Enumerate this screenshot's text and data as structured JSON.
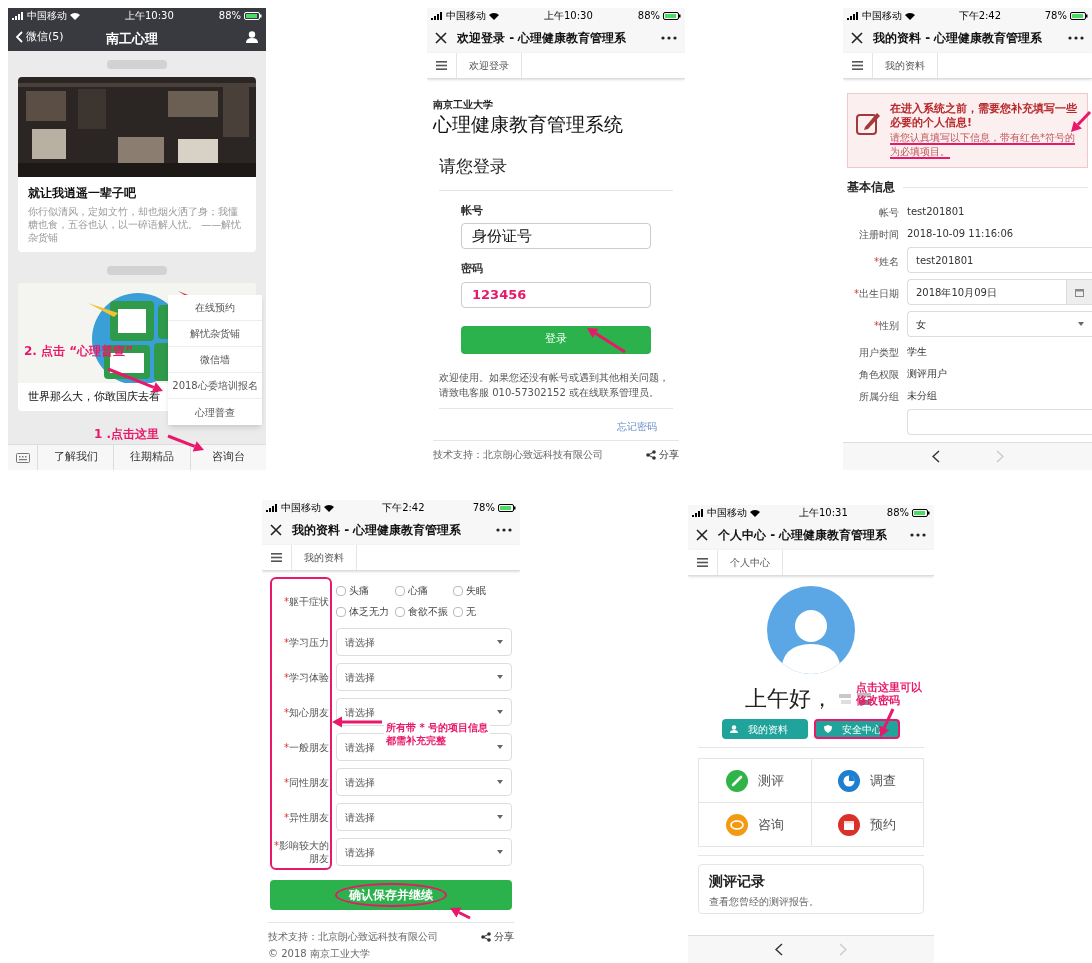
{
  "wechat_screen": {
    "status_bar": {
      "carrier": "中国移动",
      "time": "上午10:30",
      "battery": "88%"
    },
    "back_label": "微信(5)",
    "title": "南工心理",
    "articles": [
      {
        "title": "就让我逍遥一辈子吧",
        "summary": "你行似清风，定如文竹，却也烟火洒了身；我懂糖也食，五谷也认，以一碎语解人忧。 ——解忧杂货铺"
      },
      {
        "title": "世界那么大，你敢国庆去看"
      }
    ],
    "popup_menu": [
      "在线预约",
      "解忧杂货铺",
      "微信墙",
      "2018心委培训报名",
      "心理普查"
    ],
    "bottom_menu": [
      "了解我们",
      "往期精品",
      "咨询台"
    ],
    "annotations": [
      "2. 点击 “心理普查”",
      "1 .点击这里"
    ]
  },
  "login_screen": {
    "status_bar": {
      "carrier": "中国移动",
      "time": "上午10:30",
      "battery": "88%"
    },
    "title": "欢迎登录 - 心理健康教育管理系",
    "tab": "欢迎登录",
    "school": "南京工业大学",
    "system_name": "心理健康教育管理系统",
    "heading": "请您登录",
    "fields": [
      {
        "label": "帐号",
        "value": "身份证号"
      },
      {
        "label": "密码",
        "value": "123456"
      }
    ],
    "login_button": "登录",
    "notice": "欢迎使用。如果您还没有帐号或遇到其他相关问题，请致电客服 010-57302152 或在线联系管理员。",
    "forgot_link": "忘记密码",
    "footer": {
      "support": "技术支持：北京朗心致远科技有限公司",
      "share": "分享"
    }
  },
  "profile_screen": {
    "status_bar": {
      "carrier": "中国移动",
      "time": "下午2:42",
      "battery": "78%"
    },
    "title": "我的资料 - 心理健康教育管理系",
    "tab": "我的资料",
    "alert": {
      "heading": "在进入系统之前，需要您补充填写一些必要的个人信息!",
      "note": "请您认真填写以下信息，带有红色*符号的为必填项目。"
    },
    "section": "基本信息",
    "rows": [
      {
        "kind": "text",
        "label": "帐号",
        "value": "test201801"
      },
      {
        "kind": "text",
        "label": "注册时间",
        "value": "2018-10-09 11:16:06"
      },
      {
        "kind": "input",
        "mark": "*",
        "label": "姓名",
        "value": "test201801"
      },
      {
        "kind": "date",
        "mark": "*",
        "label": "出生日期",
        "value": "2018年10月09日"
      },
      {
        "kind": "select",
        "mark": "*",
        "label": "性别",
        "value": "女"
      },
      {
        "kind": "text",
        "label": "用户类型",
        "value": "学生"
      },
      {
        "kind": "text",
        "label": "角色权限",
        "value": "测评用户"
      },
      {
        "kind": "text",
        "label": "所属分组",
        "value": "未分组"
      },
      {
        "kind": "input"
      }
    ]
  },
  "symptoms_screen": {
    "status_bar": {
      "carrier": "中国移动",
      "time": "下午2:42",
      "battery": "78%"
    },
    "title": "我的资料 - 心理健康教育管理系",
    "tab": "我的资料",
    "symptoms": {
      "mark": "*",
      "label": "躯干症状",
      "options": [
        {
          "label": "头痛",
          "checked": false
        },
        {
          "label": "心痛",
          "checked": false
        },
        {
          "label": "失眠",
          "checked": false
        },
        {
          "label": "体乏无力",
          "checked": false
        },
        {
          "label": "食欲不振",
          "checked": false
        },
        {
          "label": "无",
          "checked": false
        }
      ]
    },
    "selects": [
      {
        "mark": "*",
        "label": "学习压力",
        "value": "请选择"
      },
      {
        "mark": "*",
        "label": "学习体验",
        "value": "请选择"
      },
      {
        "mark": "*",
        "label": "知心朋友",
        "value": "请选择"
      },
      {
        "mark": "*",
        "label": "一般朋友",
        "value": "请选择"
      },
      {
        "mark": "*",
        "label": "同性朋友",
        "value": "请选择"
      },
      {
        "mark": "*",
        "label": "异性朋友",
        "value": "请选择"
      },
      {
        "mark": "*",
        "label": "影响较大的朋友",
        "value": "请选择"
      }
    ],
    "annotation_lines": [
      "所有带 * 号的项目信息",
      "都需补充完整"
    ],
    "save_button": "确认保存并继续",
    "footer": {
      "support": "技术支持：北京朗心致远科技有限公司",
      "share": "分享",
      "copyright": "© 2018 南京工业大学"
    }
  },
  "personal_center_screen": {
    "status_bar": {
      "carrier": "中国移动",
      "time": "上午10:31",
      "battery": "88%"
    },
    "title": "个人中心 - 心理健康教育管理系",
    "tab": "个人中心",
    "greeting": "上午好，",
    "buttons": [
      "我的资料",
      "安全中心"
    ],
    "annotation_lines": [
      "点击这里可以",
      "修改密码"
    ],
    "features": [
      {
        "label": "测评",
        "kind": "pencil",
        "color": "#2fb44a"
      },
      {
        "label": "调查",
        "kind": "pie",
        "color": "#1e7fd1"
      },
      {
        "label": "咨询",
        "kind": "chat",
        "color": "#f29b12"
      },
      {
        "label": "预约",
        "kind": "calendar",
        "color": "#d9302a"
      }
    ],
    "record": {
      "title": "测评记录",
      "description": "查看您曾经的测评报告。"
    }
  }
}
